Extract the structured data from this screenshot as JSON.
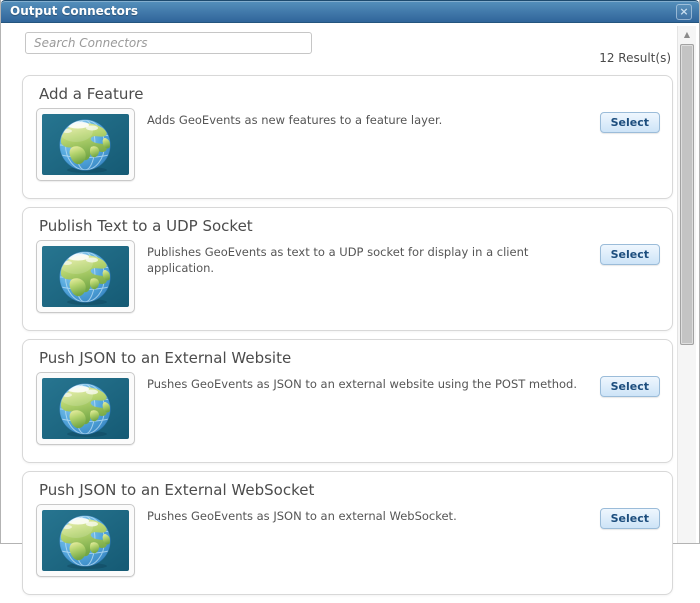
{
  "window": {
    "title": "Output Connectors",
    "close_glyph": "×"
  },
  "search": {
    "placeholder": "Search Connectors"
  },
  "results_count": "12 Result(s)",
  "labels": {
    "select": "Select"
  },
  "connectors": [
    {
      "title": "Add a Feature",
      "description": "Adds GeoEvents as new features to a feature layer."
    },
    {
      "title": "Publish Text to a UDP Socket",
      "description": "Publishes GeoEvents as text to a UDP socket for display in a client application."
    },
    {
      "title": "Push JSON to an External Website",
      "description": "Pushes GeoEvents as JSON to an external website using the POST method."
    },
    {
      "title": "Push JSON to an External WebSocket",
      "description": "Pushes GeoEvents as JSON to an external WebSocket."
    }
  ],
  "scrollbar": {
    "up_glyph": "▲"
  },
  "icons": {
    "thumbnail": "globe-icon"
  },
  "colors": {
    "header_top": "#5590bc",
    "header_bottom": "#30659a",
    "button_text": "#1c4d7d",
    "button_border": "#9bbcd9",
    "thumb_background": "#1f6e8a",
    "ocean_blue": "#4a9fd8",
    "land_green": "#a8cc66"
  }
}
